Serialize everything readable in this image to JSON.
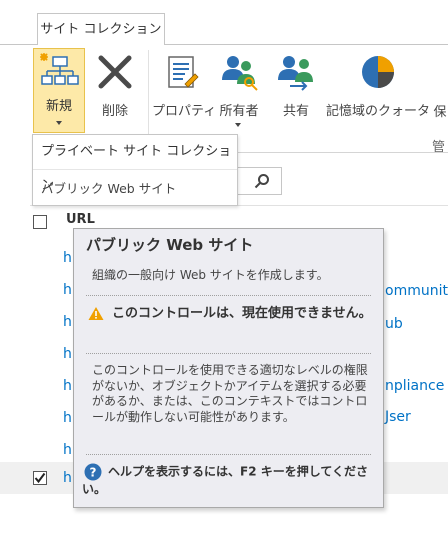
{
  "ribbon": {
    "tab_label": "サイト コレクション",
    "buttons": {
      "new": "新規",
      "delete": "削除",
      "properties": "プロパティ",
      "owners": "所有者",
      "share": "共有",
      "quota": "記憶域のクォータ",
      "truncated": "保"
    },
    "group_label_truncated": "管"
  },
  "new_menu": {
    "items": [
      "プライベート サイト コレクション",
      "パブリック Web サイト"
    ]
  },
  "list": {
    "url_header": "URL",
    "row_prefix": "h",
    "fragments": [
      "ommunit",
      "ub",
      "npliance",
      "Jser"
    ]
  },
  "tooltip": {
    "title": "パブリック Web サイト",
    "description": "組織の一般向け Web サイトを作成します。",
    "warning": "このコントロールは、現在使用できません。",
    "body": "このコントロールを使用できる適切なレベルの権限がないか、オブジェクトかアイテムを選択する必要があるか、または、このコンテキストではコントロールが動作しない可能性があります。",
    "help": "ヘルプを表示するには、F2 キーを押してください。"
  },
  "colors": {
    "link": "#0072c6",
    "selected_button_bg": "#fde9a8",
    "tooltip_bg": "#ededf2"
  }
}
